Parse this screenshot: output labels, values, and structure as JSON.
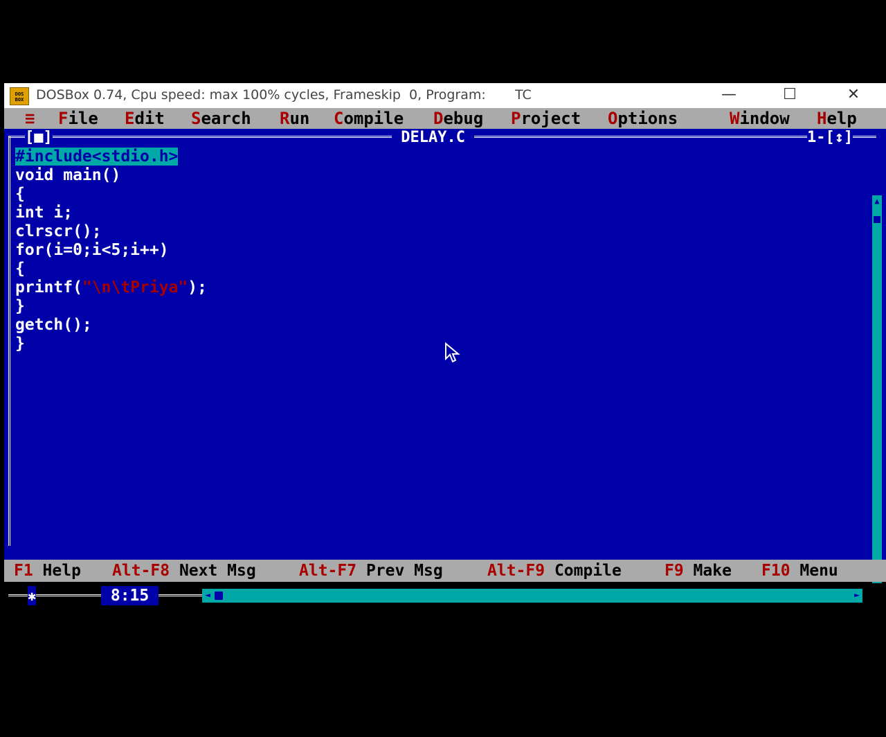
{
  "titlebar": {
    "icon_label": "DOS BOX",
    "title": "DOSBox 0.74, Cpu speed: max 100% cycles, Frameskip  0, Program:       TC",
    "minimize": "—",
    "maximize": "☐",
    "close": "✕"
  },
  "menu": {
    "system": "≡",
    "items": [
      {
        "hotkey": "F",
        "rest": "ile"
      },
      {
        "hotkey": "E",
        "rest": "dit"
      },
      {
        "hotkey": "S",
        "rest": "earch"
      },
      {
        "hotkey": "R",
        "rest": "un"
      },
      {
        "hotkey": "C",
        "rest": "ompile"
      },
      {
        "hotkey": "D",
        "rest": "ebug"
      },
      {
        "hotkey": "P",
        "rest": "roject"
      },
      {
        "hotkey": "O",
        "rest": "ptions"
      },
      {
        "hotkey": "W",
        "rest": "indow"
      },
      {
        "hotkey": "H",
        "rest": "elp"
      }
    ]
  },
  "editor": {
    "close_box": "[■]",
    "filename": " DELAY.C ",
    "window_number": "1-[↕]",
    "cursor_position": " 8:15 ",
    "lines": [
      {
        "text": "#include<stdio.h>",
        "selected": true
      },
      {
        "text": "void main()"
      },
      {
        "text": "{"
      },
      {
        "text": "int i;"
      },
      {
        "text": "clrscr();"
      },
      {
        "text": "for(i=0;i<5;i++)"
      },
      {
        "text": "{"
      },
      {
        "pre": "printf(",
        "str": "\"\\n\\tPriya\"",
        "post": ");"
      },
      {
        "text": "}"
      },
      {
        "text": "getch();"
      },
      {
        "text": "}"
      }
    ]
  },
  "scrollbars": {
    "up": "▲",
    "down": "▼",
    "left": "◄",
    "right": "►"
  },
  "hotkeys": [
    {
      "key": "F1",
      "label": " Help"
    },
    {
      "key": "Alt-F8",
      "label": " Next Msg"
    },
    {
      "key": "Alt-F7",
      "label": " Prev Msg"
    },
    {
      "key": "Alt-F9",
      "label": " Compile"
    },
    {
      "key": "F9",
      "label": " Make"
    },
    {
      "key": "F10",
      "label": " Menu"
    }
  ],
  "colors": {
    "editor_bg": "#0000a8",
    "menu_bg": "#aaaaaa",
    "hotkey_red": "#a80000",
    "selection": "#00a8a8"
  }
}
